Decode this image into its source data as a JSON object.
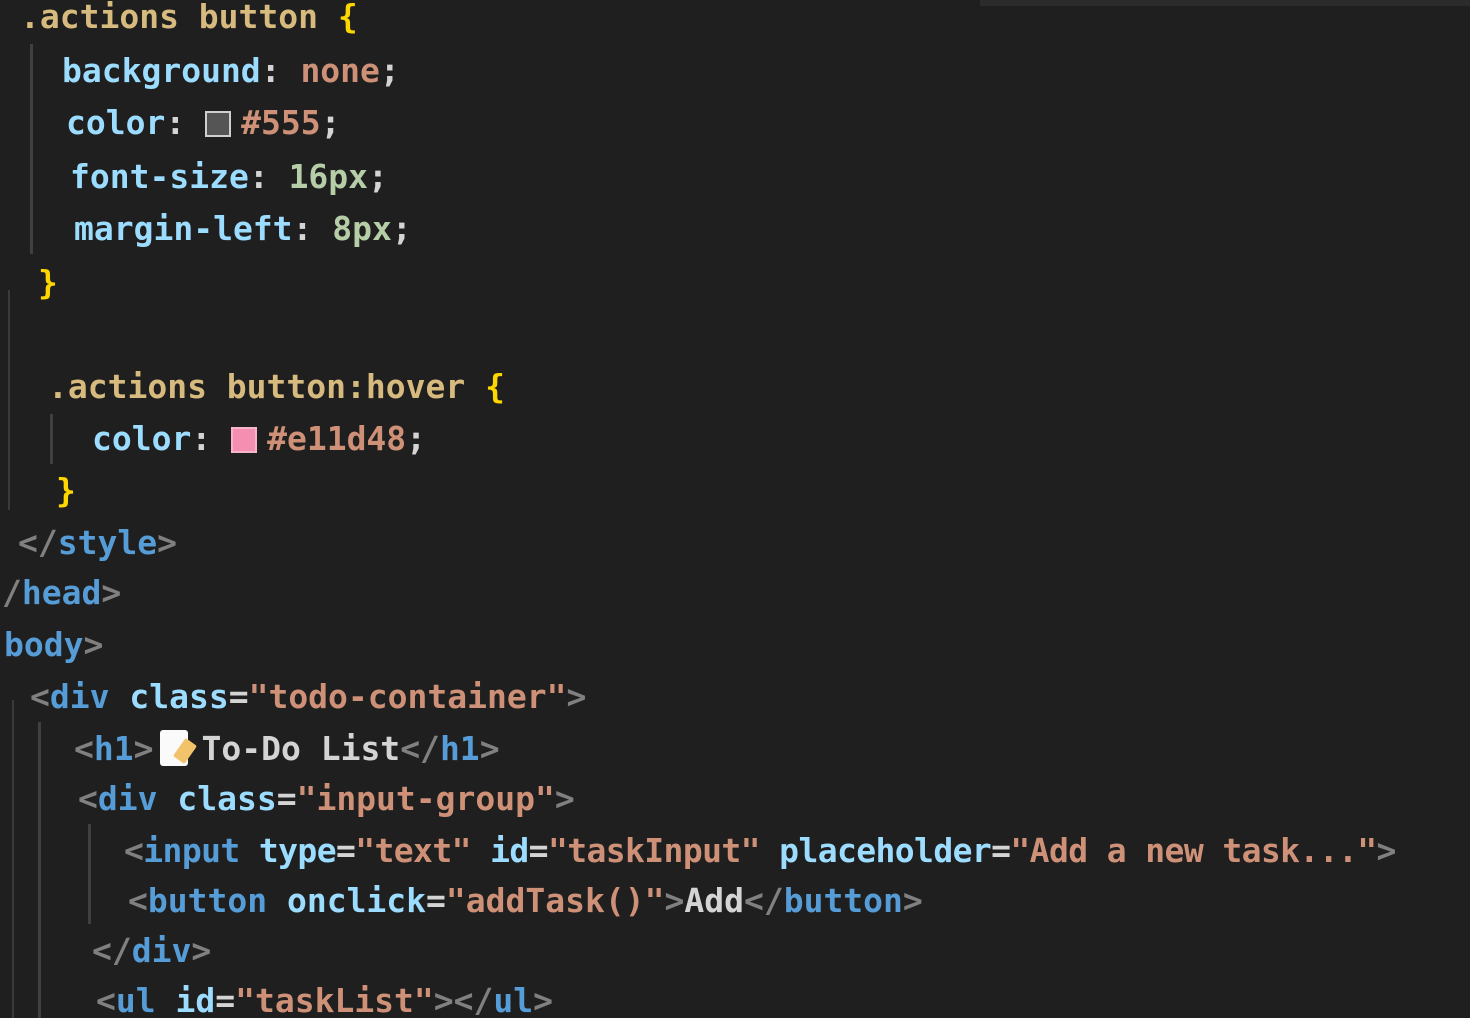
{
  "colors": {
    "background": "#1f1f1f",
    "selector": "#d7ba7d",
    "property": "#9cdcfe",
    "value": "#ce9178",
    "number": "#b5cea8",
    "brace": "#ffd700",
    "tag": "#569cd6",
    "swatch_gray": "#555555",
    "swatch_pink": "#e11d48"
  },
  "code": {
    "l1": {
      "selector": ".actions button",
      "brace": " {"
    },
    "l2": {
      "prop": "background",
      "colon": ": ",
      "value": "none",
      "semi": ";"
    },
    "l3": {
      "prop": "color",
      "colon": ": ",
      "value": "#555",
      "semi": ";"
    },
    "l4": {
      "prop": "font-size",
      "colon": ": ",
      "value": "16px",
      "semi": ";"
    },
    "l5": {
      "prop": "margin-left",
      "colon": ": ",
      "value": "8px",
      "semi": ";"
    },
    "l6": {
      "brace": "}"
    },
    "l7": {
      "selector": ".actions button:hover",
      "brace": " {"
    },
    "l8": {
      "prop": "color",
      "colon": ": ",
      "value": "#e11d48",
      "semi": ";"
    },
    "l9": {
      "brace": "}"
    },
    "l10": {
      "open": "</",
      "tag": "style",
      "close": ">"
    },
    "l11": {
      "open": "/",
      "tag": "head",
      "close": ">"
    },
    "l12": {
      "tag": "body",
      "close": ">"
    },
    "l13": {
      "open": "<",
      "tag": "div",
      "attr": " class",
      "eq": "=",
      "str": "\"todo-container\"",
      "close": ">"
    },
    "l14": {
      "open": "<",
      "tag": "h1",
      "close": ">",
      "text": "To-Do List",
      "open2": "</",
      "tag2": "h1",
      "close2": ">"
    },
    "l15": {
      "open": "<",
      "tag": "div",
      "attr": " class",
      "eq": "=",
      "str": "\"input-group\"",
      "close": ">"
    },
    "l16": {
      "open": "<",
      "tag": "input",
      "attr1": " type",
      "eq1": "=",
      "str1": "\"text\"",
      "attr2": " id",
      "eq2": "=",
      "str2": "\"taskInput\"",
      "attr3": " placeholder",
      "eq3": "=",
      "str3": "\"Add a new task...\"",
      "close": ">"
    },
    "l17": {
      "open": "<",
      "tag": "button",
      "attr": " onclick",
      "eq": "=",
      "str": "\"addTask()\"",
      "close": ">",
      "text": "Add",
      "open2": "</",
      "tag2": "button",
      "close2": ">"
    },
    "l18": {
      "open": "</",
      "tag": "div",
      "close": ">"
    },
    "l19": {
      "open": "<",
      "tag": "ul",
      "attr": " id",
      "eq": "=",
      "str": "\"taskList\"",
      "close": ">",
      "open2": "</",
      "tag2": "ul",
      "close2": ">"
    }
  }
}
